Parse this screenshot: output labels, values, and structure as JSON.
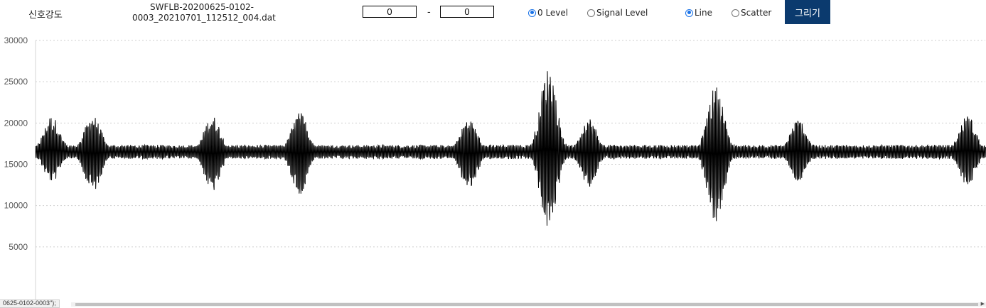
{
  "toolbar": {
    "signal_label": "신호강도",
    "filename_line1": "SWFLB-20200625-0102-",
    "filename_line2": "0003_20210701_112512_004.dat",
    "range_start": "0",
    "range_separator": "-",
    "range_end": "0",
    "level_options": [
      {
        "label": "0 Level",
        "selected": true
      },
      {
        "label": "Signal Level",
        "selected": false
      }
    ],
    "plot_options": [
      {
        "label": "Line",
        "selected": true
      },
      {
        "label": "Scatter",
        "selected": false
      }
    ],
    "draw_button_label": "그리기",
    "draw_button_color": "#0b3a6e",
    "radio_accent_color": "#1a73e8"
  },
  "status_text": "0625-0102-0003\");",
  "chart_data": {
    "type": "line",
    "title": "",
    "xlabel": "",
    "ylabel": "",
    "ylim": [
      0,
      30000
    ],
    "yticks": [
      5000,
      10000,
      15000,
      20000,
      25000,
      30000
    ],
    "ytick_labels": [
      "5000",
      "10000",
      "15000",
      "20000",
      "25000",
      "30000"
    ],
    "grid": "horizontal dotted",
    "line_color": "#000000",
    "x_points": 1336,
    "series": [
      {
        "baseline": 16500,
        "noise_amplitude": 700,
        "bursts": [
          {
            "x_fraction": 0.017,
            "max": 20900,
            "min": 12800
          },
          {
            "x_fraction": 0.06,
            "max": 21000,
            "min": 11600
          },
          {
            "x_fraction": 0.186,
            "max": 20900,
            "min": 11600
          },
          {
            "x_fraction": 0.278,
            "max": 21300,
            "min": 11300
          },
          {
            "x_fraction": 0.456,
            "max": 20600,
            "min": 11900
          },
          {
            "x_fraction": 0.54,
            "max": 26800,
            "min": 7100
          },
          {
            "x_fraction": 0.582,
            "max": 20700,
            "min": 12000
          },
          {
            "x_fraction": 0.716,
            "max": 24500,
            "min": 7900
          },
          {
            "x_fraction": 0.803,
            "max": 20500,
            "min": 12800
          },
          {
            "x_fraction": 0.981,
            "max": 21000,
            "min": 12400
          }
        ]
      }
    ]
  }
}
